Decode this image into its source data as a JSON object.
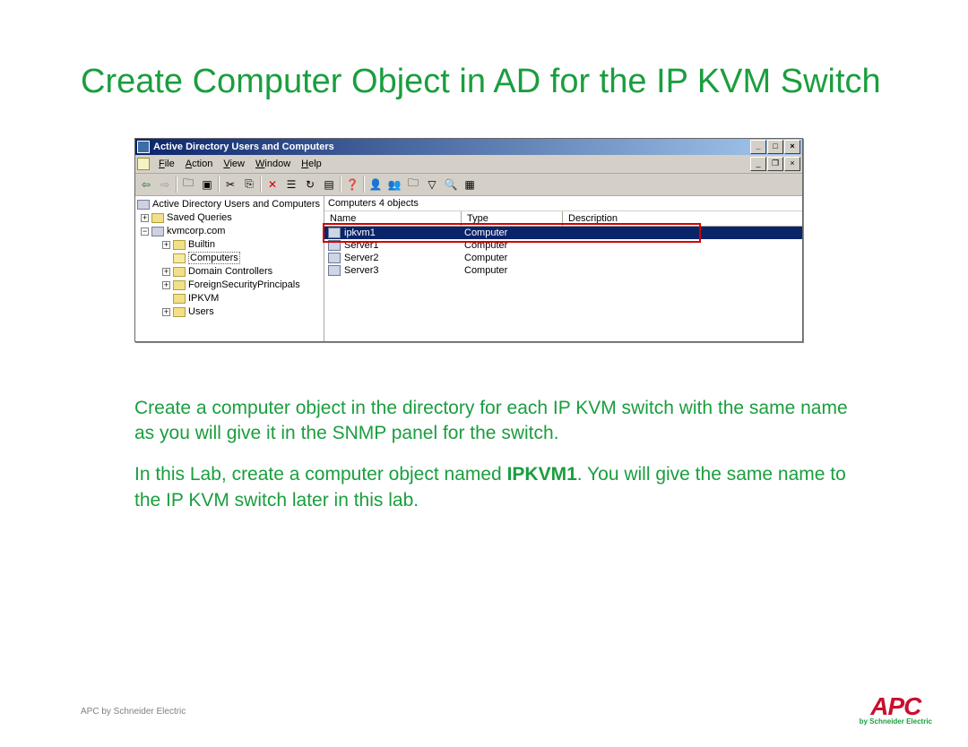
{
  "slide": {
    "title": "Create Computer Object in AD for the IP KVM Switch",
    "body1": "Create a computer object in the directory for each IP KVM switch with the same name as you will give it in the SNMP panel for the switch.",
    "body2a": "In this Lab, create a computer object named ",
    "body2b": "IPKVM1",
    "body2c": ".  You will give the same name to the IP KVM switch later in this lab.",
    "footer": "APC by Schneider Electric",
    "logo_main": "APC",
    "logo_sub": "by Schneider Electric"
  },
  "window": {
    "title": "Active Directory Users and Computers",
    "menus": {
      "file": "File",
      "action": "Action",
      "view": "View",
      "window": "Window",
      "help": "Help"
    },
    "ctrlbtns": {
      "min": "_",
      "max": "□",
      "close": "×"
    },
    "mdibtns": {
      "min": "_",
      "restore": "❐",
      "close": "×"
    },
    "tree": {
      "root": "Active Directory Users and Computers",
      "saved": "Saved Queries",
      "domain": "kvmcorp.com",
      "builtin": "Builtin",
      "computers": "Computers",
      "dc": "Domain Controllers",
      "fsp": "ForeignSecurityPrincipals",
      "ipkvm": "IPKVM",
      "users": "Users"
    },
    "list": {
      "header": "Computers   4 objects",
      "col_name": "Name",
      "col_type": "Type",
      "col_desc": "Description",
      "rows": {
        "r0_name": "ipkvm1",
        "r0_type": "Computer",
        "r1_name": "Server1",
        "r1_type": "Computer",
        "r2_name": "Server2",
        "r2_type": "Computer",
        "r3_name": "Server3",
        "r3_type": "Computer"
      }
    }
  }
}
